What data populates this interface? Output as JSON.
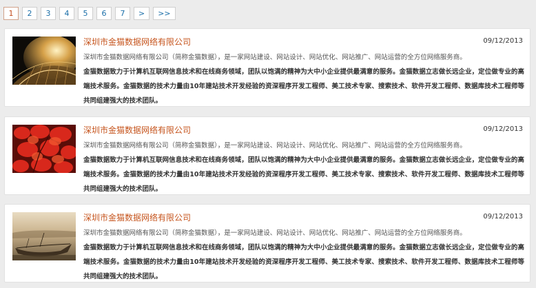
{
  "pagination": {
    "pages": [
      "1",
      "2",
      "3",
      "4",
      "5",
      "6",
      "7"
    ],
    "next": ">",
    "last": ">>",
    "current": "1"
  },
  "articles": [
    {
      "title": "深圳市金猫数据网络有限公司",
      "date": "09/12/2013",
      "subtitle": "深圳市金猫数据网络有限公司（简称金猫数据），是一家网站建设、网站设计、网站优化、网站推广、网站运营的全方位网络服务商。",
      "description": "金猫数据致力于计算机互联网信息技术和在线商务领域，团队以饱满的精神为大中小企业提供最满意的服务。金猫数据立志做长远企业，定位做专业的高端技术服务。金猫数据的技术力量由10年建站技术开发经验的资深程序开发工程师、美工技术专家、搜索技术、软件开发工程师、数据库技术工程师等共同组建强大的技术团队。",
      "image": "night-dome-building"
    },
    {
      "title": "深圳市金猫数据网络有限公司",
      "date": "09/12/2013",
      "subtitle": "深圳市金猫数据网络有限公司（简称金猫数据），是一家网站建设、网站设计、网站优化、网站推广、网站运营的全方位网络服务商。",
      "description": "金猫数据致力于计算机互联网信息技术和在线商务领域，团队以饱满的精神为大中小企业提供最满意的服务。金猫数据立志做长远企业，定位做专业的高端技术服务。金猫数据的技术力量由10年建站技术开发经验的资深程序开发工程师、美工技术专家、搜索技术、软件开发工程师、数据库技术工程师等共同组建强大的技术团队。",
      "image": "red-autumn-leaves"
    },
    {
      "title": "深圳市金猫数据网络有限公司",
      "date": "09/12/2013",
      "subtitle": "深圳市金猫数据网络有限公司（简称金猫数据），是一家网站建设、网站设计、网站优化、网站推广、网站运营的全方位网络服务商。",
      "description": "金猫数据致力于计算机互联网信息技术和在线商务领域，团队以饱满的精神为大中小企业提供最满意的服务。金猫数据立志做长远企业，定位做专业的高端技术服务。金猫数据的技术力量由10年建站技术开发经验的资深程序开发工程师、美工技术专家、搜索技术、软件开发工程师、数据库技术工程师等共同组建强大的技术团队。",
      "image": "sepia-boat"
    }
  ]
}
